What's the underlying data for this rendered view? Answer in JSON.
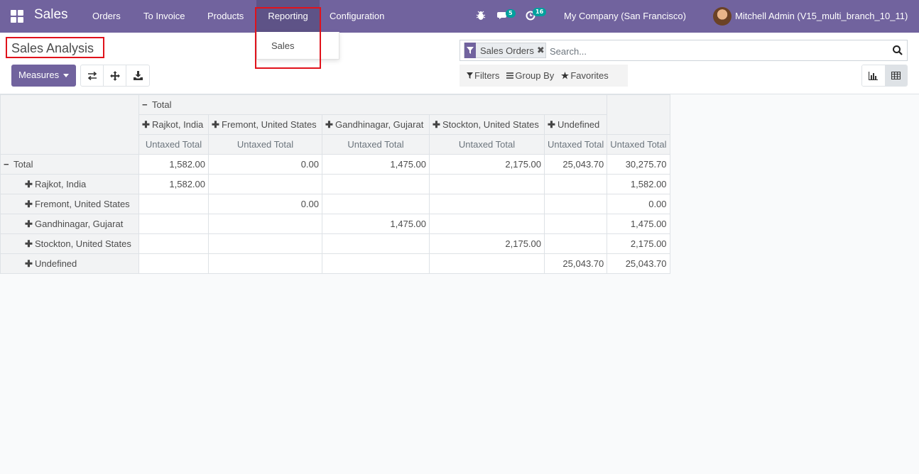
{
  "app": {
    "name": "Sales"
  },
  "nav": {
    "items": [
      "Orders",
      "To Invoice",
      "Products",
      "Reporting",
      "Configuration"
    ],
    "messages_count": "5",
    "activities_count": "16",
    "company": "My Company (San Francisco)",
    "user": "Mitchell Admin (V15_multi_branch_10_11)"
  },
  "dropdown": {
    "items": [
      "Sales"
    ]
  },
  "page": {
    "title": "Sales Analysis"
  },
  "toolbar": {
    "measures_label": "Measures"
  },
  "search": {
    "facet": "Sales Orders",
    "placeholder": "Search..."
  },
  "filters": {
    "filters_label": "Filters",
    "groupby_label": "Group By",
    "favorites_label": "Favorites"
  },
  "pivot": {
    "col_total": "Total",
    "columns": [
      "Rajkot, India",
      "Fremont, United States",
      "Gandhinagar, Gujarat",
      "Stockton, United States",
      "Undefined"
    ],
    "measure": "Untaxed Total",
    "row_total": "Total",
    "total_values": [
      "1,582.00",
      "0.00",
      "1,475.00",
      "2,175.00",
      "25,043.70",
      "30,275.70"
    ],
    "rows": [
      {
        "label": "Rajkot, India",
        "values": [
          "1,582.00",
          "",
          "",
          "",
          "",
          "1,582.00"
        ]
      },
      {
        "label": "Fremont, United States",
        "values": [
          "",
          "0.00",
          "",
          "",
          "",
          "0.00"
        ]
      },
      {
        "label": "Gandhinagar, Gujarat",
        "values": [
          "",
          "",
          "1,475.00",
          "",
          "",
          "1,475.00"
        ]
      },
      {
        "label": "Stockton, United States",
        "values": [
          "",
          "",
          "",
          "2,175.00",
          "",
          "2,175.00"
        ]
      },
      {
        "label": "Undefined",
        "values": [
          "",
          "",
          "",
          "",
          "25,043.70",
          "25,043.70"
        ]
      }
    ]
  },
  "colors": {
    "brand": "#71639e",
    "badge": "#00a09d",
    "highlight": "#e0121b"
  }
}
